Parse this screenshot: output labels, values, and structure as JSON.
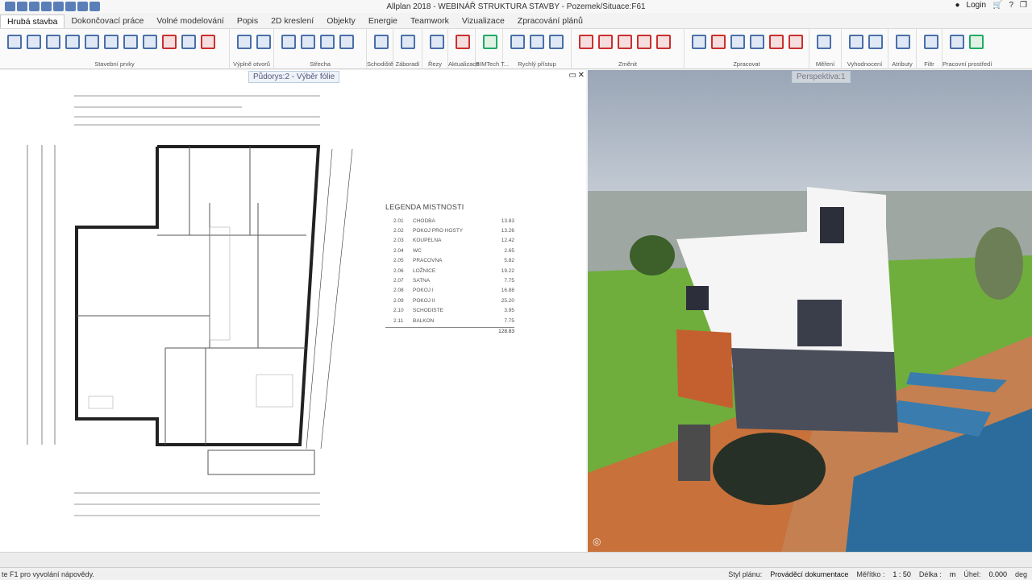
{
  "window": {
    "title": "Allplan 2018 - WEBINÁŘ STRUKTURA STAVBY - Pozemek/Situace:F61",
    "login_label": "Login"
  },
  "menu": {
    "items": [
      "Hrubá stavba",
      "Dokončovací práce",
      "Volné modelování",
      "Popis",
      "2D kreslení",
      "Objekty",
      "Energie",
      "Teamwork",
      "Vizualizace",
      "Zpracování plánů"
    ]
  },
  "ribbon": {
    "groups": [
      "Stavební prvky",
      "Výplně otvorů",
      "Střecha",
      "Schodiště",
      "Záboradí",
      "Řezy",
      "Aktualizace",
      "BIMTech T...",
      "Rychlý přístup",
      "Změnit",
      "Zpracovat",
      "Měření",
      "Vyhodnocení",
      "Atributy",
      "Filtr",
      "Pracovní prostředí"
    ]
  },
  "viewports": {
    "left_title": "Půdorys:2 - Výběr fólie",
    "right_title": "Perspektiva:1"
  },
  "legend": {
    "title": "LEGENDA MISTNOSTI",
    "rows": [
      {
        "no": "2.01",
        "name": "CHODBA",
        "area": "13.83"
      },
      {
        "no": "2.02",
        "name": "POKOJ PRO HOSTY",
        "area": "13.26"
      },
      {
        "no": "2.03",
        "name": "KOUPELNA",
        "area": "12.42"
      },
      {
        "no": "2.04",
        "name": "WC",
        "area": "2.65"
      },
      {
        "no": "2.05",
        "name": "PRACOVNA",
        "area": "5.82"
      },
      {
        "no": "2.06",
        "name": "LOŽNICE",
        "area": "19.22"
      },
      {
        "no": "2.07",
        "name": "SATNA",
        "area": "7.75"
      },
      {
        "no": "2.08",
        "name": "POKOJ I",
        "area": "16.88"
      },
      {
        "no": "2.09",
        "name": "POKOJ II",
        "area": "25.20"
      },
      {
        "no": "2.10",
        "name": "SCHODISTE",
        "area": "3.95"
      },
      {
        "no": "2.11",
        "name": "BALKON",
        "area": "7.75"
      }
    ],
    "total": "128.83"
  },
  "status": {
    "help": "te F1 pro vyvolání nápovědy.",
    "plan_style_label": "Styl plánu:",
    "plan_style_value": "Prováděcí dokumentace",
    "scale_label": "Měřítko :",
    "scale_value": "1 : 50",
    "length_label": "Délka :",
    "length_value": "m",
    "angle_label": "Úhel:",
    "angle_value": "0.000",
    "angle_unit": "deg"
  }
}
